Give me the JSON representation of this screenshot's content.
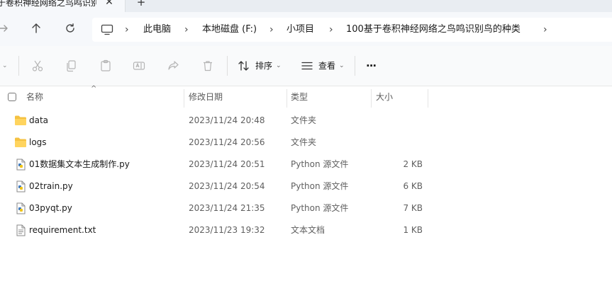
{
  "tab": {
    "title": "于卷积神经网络之鸟鸣识别",
    "close_glyph": "✕",
    "add_glyph": "+"
  },
  "nav": {
    "forward_icon": "forward-arrow-icon",
    "up_icon": "up-arrow-icon",
    "refresh_icon": "refresh-icon"
  },
  "address": {
    "monitor_icon": "monitor-icon",
    "separator": "›",
    "crumbs": [
      "此电脑",
      "本地磁盘 (F:)",
      "小项目",
      "100基于卷积神经网络之鸟鸣识别鸟的种类"
    ]
  },
  "toolbar": {
    "sort_label": "排序",
    "view_label": "查看",
    "more_label": "···",
    "caret": "⌄"
  },
  "columns": {
    "name": "名称",
    "date": "修改日期",
    "type": "类型",
    "size": "大小"
  },
  "files": [
    {
      "name": "data",
      "date": "2023/11/24 20:48",
      "type": "文件夹",
      "size": "",
      "icon": "folder-icon"
    },
    {
      "name": "logs",
      "date": "2023/11/24 20:56",
      "type": "文件夹",
      "size": "",
      "icon": "folder-icon"
    },
    {
      "name": "01数据集文本生成制作.py",
      "date": "2023/11/24 20:51",
      "type": "Python 源文件",
      "size": "2 KB",
      "icon": "python-file-icon"
    },
    {
      "name": "02train.py",
      "date": "2023/11/24 20:54",
      "type": "Python 源文件",
      "size": "6 KB",
      "icon": "python-file-icon"
    },
    {
      "name": "03pyqt.py",
      "date": "2023/11/24 21:35",
      "type": "Python 源文件",
      "size": "7 KB",
      "icon": "python-file-icon"
    },
    {
      "name": "requirement.txt",
      "date": "2023/11/23 19:32",
      "type": "文本文档",
      "size": "1 KB",
      "icon": "text-file-icon"
    }
  ],
  "colors": {
    "folder": "#f5c242",
    "python_blue": "#3b78c2",
    "accent": "#0067c0"
  }
}
